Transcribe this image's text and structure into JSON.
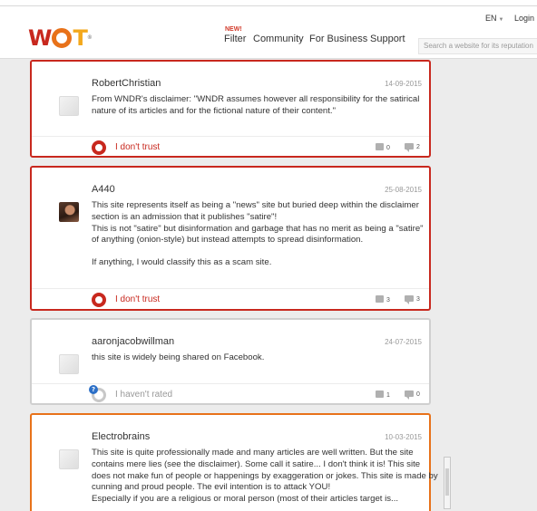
{
  "header": {
    "logo": {
      "w": "W",
      "t": "T",
      "reg": "®"
    },
    "lang": "EN",
    "login": "Login",
    "nav_new_badge": "NEW!",
    "nav": [
      "Filter",
      "Community",
      "For Business",
      "Support"
    ],
    "search_placeholder": "Search a website for its reputation"
  },
  "reviews": [
    {
      "author": "RobertChristian",
      "date": "14-09-2015",
      "paragraphs": [
        "From WNDR's disclaimer: \"WNDR assumes however all responsibility for the satirical nature of its articles and for the fictional nature of their content.\""
      ],
      "rating": "I don't trust",
      "upvotes": "0",
      "comments": "2"
    },
    {
      "author": "A440",
      "date": "25-08-2015",
      "paragraphs": [
        "This site represents itself as being a \"news\" site but buried deep within the disclaimer section is an admission that it publishes \"satire\"!",
        "This is not \"satire\" but disinformation and garbage that has no merit as being a \"satire\" of anything (onion-style) but instead attempts to spread disinformation.",
        "If anything, I would classify this as a scam site."
      ],
      "rating": "I don't trust",
      "upvotes": "3",
      "comments": "3"
    },
    {
      "author": "aaronjacobwillman",
      "date": "24-07-2015",
      "paragraphs": [
        "this site is widely being shared on Facebook."
      ],
      "rating": "I haven't rated",
      "upvotes": "1",
      "comments": "0"
    },
    {
      "author": "Electrobrains",
      "date": "10-03-2015",
      "paragraphs": [
        "This site is quite professionally made and many articles are well written. But the site contains mere lies (see the disclaimer). Some call it satire... I don't think it is! This site does not make fun of people or happenings by exaggeration or jokes. This site is made by cunning and proud people. The evil intention is to attack YOU!",
        "Especially if you are a religious or moral person (most of their articles target is..."
      ]
    }
  ],
  "colors": {
    "untrusted": "#c8281e",
    "caution": "#e8721a"
  }
}
